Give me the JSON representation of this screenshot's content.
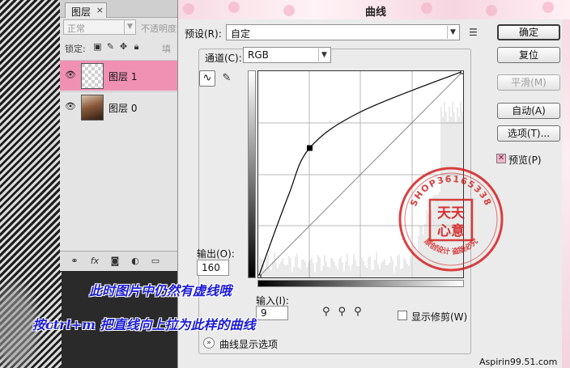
{
  "layers_panel": {
    "tab_label": "图层",
    "tab_close": "×",
    "blend_mode": "正常",
    "opacity_label": "不透明度",
    "lock_label": "锁定:",
    "fill_label": "填",
    "layers": [
      {
        "name": "图层 1",
        "selected": true
      },
      {
        "name": "图层 0",
        "selected": false
      }
    ],
    "bottom_icons": [
      "link-icon",
      "fx-icon",
      "mask-icon",
      "adjustment-icon",
      "group-icon"
    ]
  },
  "curves_dialog": {
    "title": "曲线",
    "preset_label": "预设(R):",
    "preset_value": "自定",
    "channel_label": "通道(C):",
    "channel_value": "RGB",
    "output_label": "输出(O):",
    "output_value": "160",
    "input_label": "输入(I):",
    "input_value": "9",
    "show_clipping_label": "显示修剪(W)",
    "curve_display_options_label": "曲线显示选项",
    "preview_label": "预览(P)",
    "preview_checked": true,
    "buttons": {
      "ok": "确定",
      "reset": "复位",
      "smooth": "平滑(M)",
      "auto": "自动(A)",
      "options": "选项(T)..."
    },
    "curve": {
      "x": [
        0,
        37,
        64,
        128,
        255
      ],
      "y": [
        0,
        100,
        160,
        205,
        255
      ]
    }
  },
  "annotations": {
    "line1": "此时图片中仍然有虚线哦",
    "line2": "按ctrl+m  把直线向上拉为此样的曲线"
  },
  "stamp": {
    "top_text": "SHOP36165338",
    "center_line1": "天天",
    "center_line2": "心意",
    "bottom_text": "原创设计 盗版必究"
  },
  "watermark": "Aspirin99.51.com",
  "colors": {
    "stamp_red": "#d42020",
    "annotation_blue": "#1c1cd6",
    "selected_layer": "#f091b4"
  }
}
